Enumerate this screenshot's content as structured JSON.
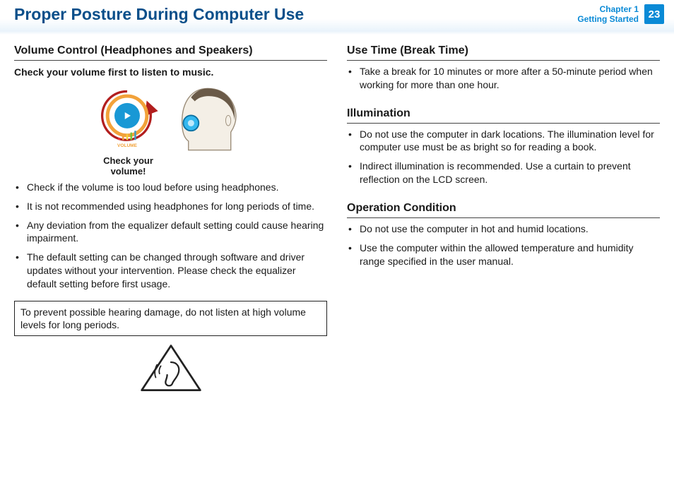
{
  "header": {
    "title": "Proper Posture During Computer Use",
    "chapter_line1": "Chapter 1",
    "chapter_line2": "Getting Started",
    "page_number": "23"
  },
  "left": {
    "section": "Volume Control (Headphones and Speakers)",
    "subtitle": "Check your volume first to listen to music.",
    "fig_caption": "Check your volume!",
    "fig_volume_label": "VOLUME",
    "bullets": [
      "Check if the volume is too loud before using headphones.",
      "It is not recommended using headphones for long periods of time.",
      "Any deviation from the equalizer default setting could cause hearing impairment.",
      "The default setting can be changed through software and driver updates without your intervention. Please check the equalizer default setting before first usage."
    ],
    "warning": "To prevent possible hearing damage, do not listen at high volume levels for long periods."
  },
  "right": {
    "s1": {
      "heading": "Use Time (Break Time)",
      "bullets": [
        "Take a break for 10 minutes or more after a 50-minute period when working for more than one hour."
      ]
    },
    "s2": {
      "heading": "Illumination",
      "bullets": [
        "Do not use the computer in dark locations. The illumination level for computer use must be as bright so for reading a book.",
        "Indirect illumination is recommended. Use a curtain to prevent reflection on the LCD screen."
      ]
    },
    "s3": {
      "heading": "Operation Condition",
      "bullets": [
        "Do not use the computer in hot and humid locations.",
        "Use the computer within the allowed temperature and humidity range specified in the user manual."
      ]
    }
  }
}
